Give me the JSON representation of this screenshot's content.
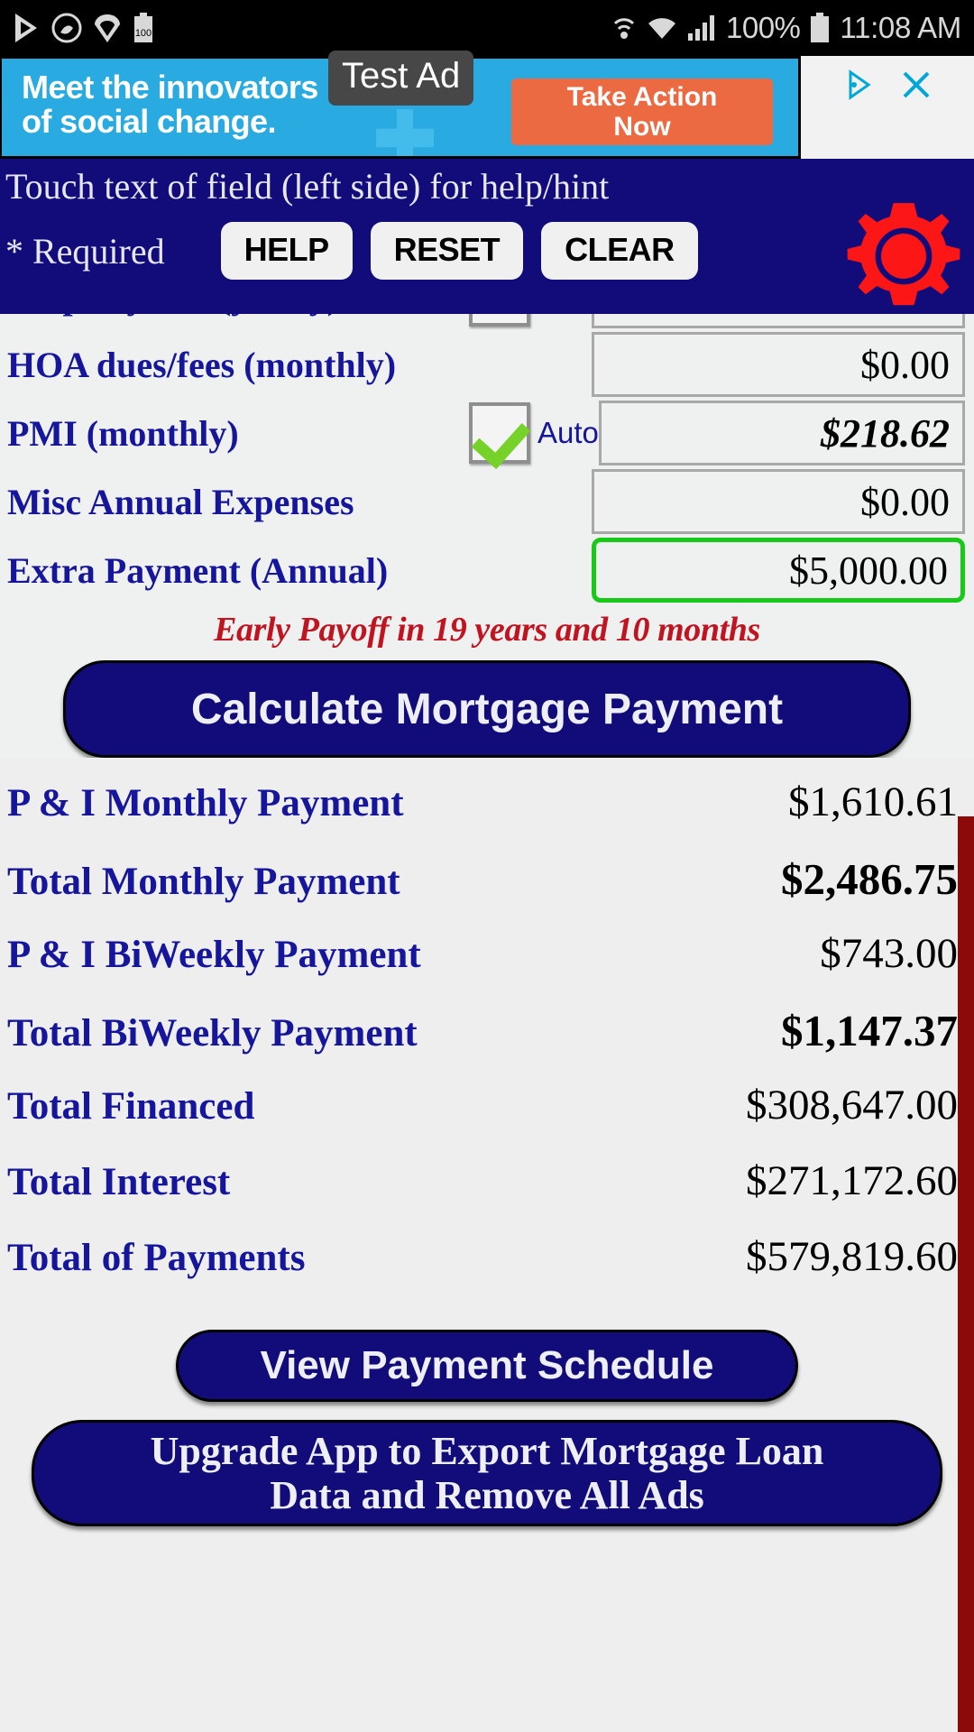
{
  "status_bar": {
    "icons": [
      "play-store-icon",
      "music-icon",
      "wifi-signal-icon",
      "battery-saver-icon"
    ],
    "battery_percent": "100%",
    "time": "11:08 AM"
  },
  "ad": {
    "label": "Test Ad",
    "headline_line1": "Meet the innovators",
    "headline_line2": "of social change.",
    "cta_line1": "Take Action",
    "cta_line2": "Now",
    "info_icon": "ad-choices-icon",
    "close_icon": "close-icon",
    "bg_color": "#29abe2",
    "cta_color": "#ec6a42"
  },
  "header": {
    "hint": "Touch text of field (left side) for help/hint",
    "required_note": "* Required",
    "buttons": [
      {
        "label": "HELP",
        "name": "help-button"
      },
      {
        "label": "RESET",
        "name": "reset-button"
      },
      {
        "label": "CLEAR",
        "name": "clear-button"
      }
    ],
    "settings_icon": "gear-icon",
    "bg_color": "#110c7a",
    "gear_color": "#fc1616"
  },
  "form": {
    "rows": [
      {
        "label": "HOA dues/fees (monthly)",
        "value": "$0.00",
        "checkbox": null,
        "checkbox_label": null,
        "focused": false,
        "emphasis": "normal"
      },
      {
        "label": "PMI (monthly)",
        "value": "$218.62",
        "checkbox": "checked",
        "checkbox_label": "Auto",
        "focused": false,
        "emphasis": "bold-italic"
      },
      {
        "label": "Misc Annual Expenses",
        "value": "$0.00",
        "checkbox": null,
        "checkbox_label": null,
        "focused": false,
        "emphasis": "normal"
      },
      {
        "label": "Extra Payment (Annual)",
        "value": "$5,000.00",
        "checkbox": null,
        "checkbox_label": null,
        "focused": true,
        "emphasis": "normal"
      }
    ],
    "early_payoff": "Early Payoff in 19 years and 10 months",
    "calculate_label": "Calculate Mortgage Payment"
  },
  "results": {
    "rows": [
      {
        "label": "P & I Monthly Payment",
        "value": "$1,610.61",
        "strong": false
      },
      {
        "label": "Total Monthly Payment",
        "value": "$2,486.75",
        "strong": true
      },
      {
        "label": "P & I BiWeekly Payment",
        "value": "$743.00",
        "strong": false
      },
      {
        "label": "Total BiWeekly Payment",
        "value": "$1,147.37",
        "strong": true
      },
      {
        "label": "Total Financed",
        "value": "$308,647.00",
        "strong": false
      },
      {
        "label": "Total Interest",
        "value": "$271,172.60",
        "strong": false
      },
      {
        "label": "Total of Payments",
        "value": "$579,819.60",
        "strong": false
      }
    ]
  },
  "footer": {
    "schedule_label": "View Payment Schedule",
    "upgrade_line1": "Upgrade App to Export Mortgage Loan",
    "upgrade_line2": "Data and Remove All Ads"
  },
  "colors": {
    "app_blue": "#110c7a",
    "label_blue": "#16169c",
    "payoff_red": "#c01520",
    "focus_green": "#19c919",
    "scrollbar": "#8c0a0a"
  }
}
